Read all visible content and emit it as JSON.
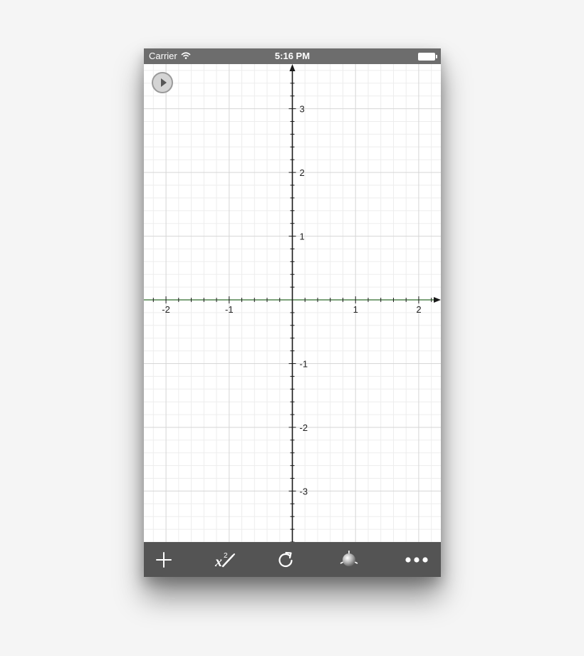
{
  "status_bar": {
    "carrier": "Carrier",
    "time": "5:16 PM"
  },
  "graph": {
    "x_range": [
      -2.35,
      2.35
    ],
    "y_range": [
      -3.8,
      3.7
    ],
    "x_tick_labels": [
      "-2",
      "-1",
      "1",
      "2"
    ],
    "y_tick_labels": [
      "3",
      "2",
      "1",
      "-1",
      "-2",
      "-3"
    ],
    "axis_color": "#1a1a1a",
    "x_axis_color": "#2f6b2b",
    "grid_major_color": "#d6d6d6",
    "grid_minor_color": "#ededed"
  },
  "toolbar": {
    "items": [
      {
        "icon": "plus-icon"
      },
      {
        "icon": "equation-edit-icon"
      },
      {
        "icon": "refresh-icon"
      },
      {
        "icon": "sphere-icon"
      },
      {
        "icon": "more-icon"
      }
    ]
  },
  "colors": {
    "status_bar": "#6d6d6d",
    "toolbar": "#545454",
    "background": "#f5f5f5"
  }
}
